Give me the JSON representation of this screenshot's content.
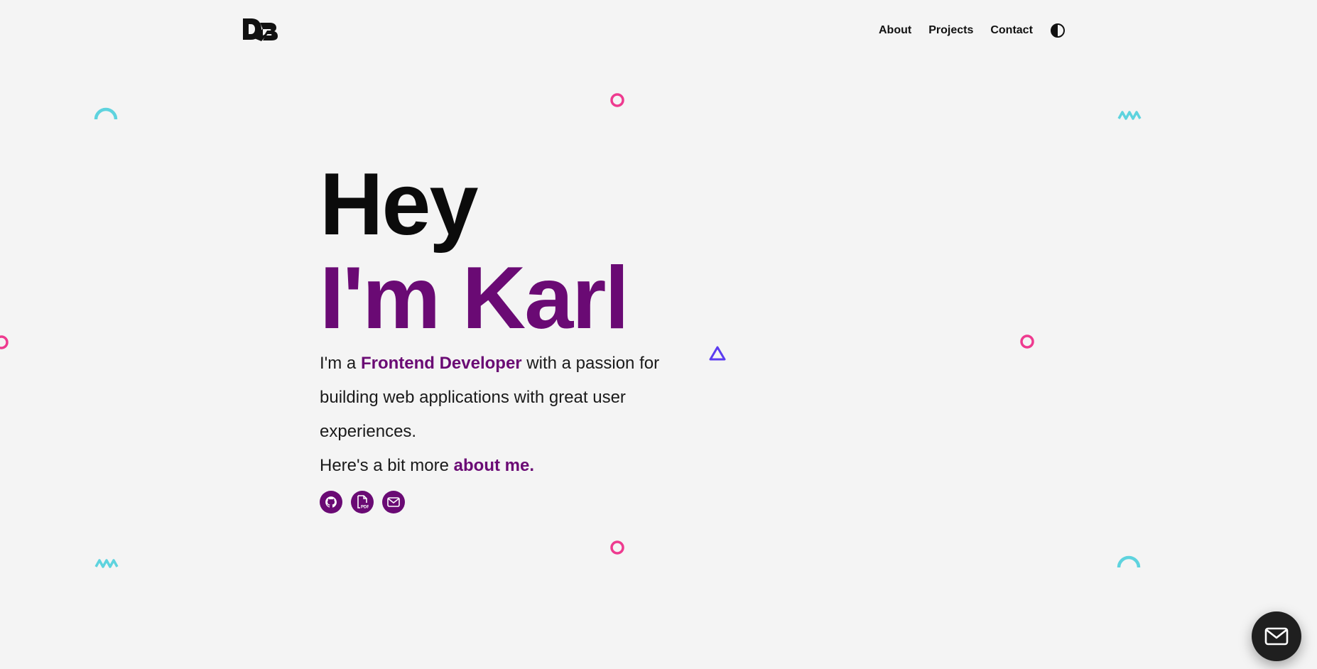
{
  "header": {
    "logo_text": "DB",
    "nav": [
      {
        "label": "About"
      },
      {
        "label": "Projects"
      },
      {
        "label": "Contact"
      }
    ]
  },
  "hero": {
    "greeting": "Hey",
    "name_line": "I'm Karl",
    "intro_prefix": "I'm a ",
    "intro_highlight": "Frontend Developer",
    "intro_suffix": " with a passion for building web applications with great user experiences.",
    "more_prefix": "Here's a bit more ",
    "more_link": "about me."
  },
  "socials": [
    {
      "icon": "github-icon"
    },
    {
      "icon": "pdf-icon"
    },
    {
      "icon": "mail-icon"
    }
  ],
  "colors": {
    "accent": "#6a0a74",
    "background": "#f4f4f4",
    "deco_pink": "#ee3a8f",
    "deco_cyan": "#5ed3de",
    "deco_blue": "#5b3cf0"
  }
}
